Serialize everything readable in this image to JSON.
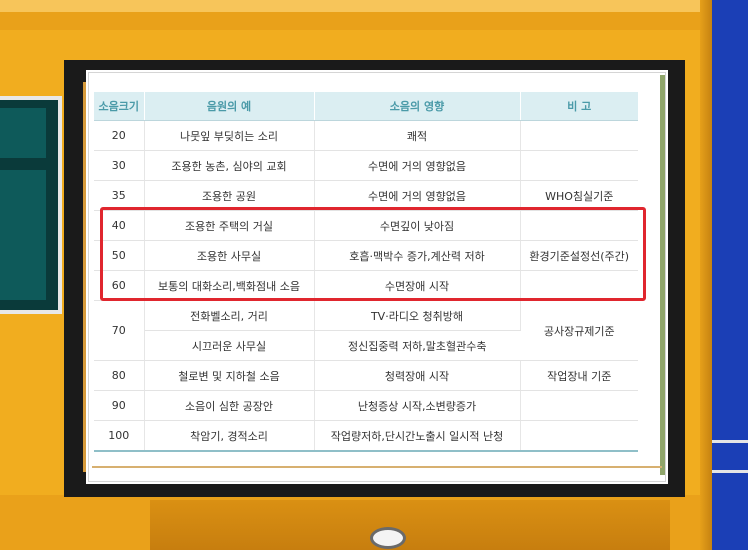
{
  "table": {
    "headers": [
      "소음크기",
      "음원의 예",
      "소음의 영향",
      "비 고"
    ],
    "rows": [
      {
        "db": "20",
        "source": "나뭇잎 부딪히는 소리",
        "effect": "쾌적",
        "note": ""
      },
      {
        "db": "30",
        "source": "조용한 농촌, 심야의 교회",
        "effect": "수면에 거의 영향없음",
        "note": ""
      },
      {
        "db": "35",
        "source": "조용한 공원",
        "effect": "수면에 거의 영향없음",
        "note": "WHO침실기준"
      },
      {
        "db": "40",
        "source": "조용한 주택의 거실",
        "effect": "수면깊이 낮아짐",
        "note": ""
      },
      {
        "db": "50",
        "source": "조용한 사무실",
        "effect": "호흡·맥박수 증가,계산력 저하",
        "note": "환경기준설정선(주간)"
      },
      {
        "db": "60",
        "source": "보통의 대화소리,백화점내 소음",
        "effect": "수면장애 시작",
        "note": ""
      },
      {
        "db": "70",
        "source": "전화벨소리, 거리",
        "effect": "TV·라디오 청취방해",
        "note": "공사장규제기준"
      },
      {
        "db": "",
        "source": "시끄러운 사무실",
        "effect": "정신집중력 저하,말초혈관수축",
        "note": ""
      },
      {
        "db": "80",
        "source": "철로변 및 지하철 소음",
        "effect": "청력장애 시작",
        "note": "작업장내 기준"
      },
      {
        "db": "90",
        "source": "소음이 심한 공장안",
        "effect": "난청증상 시작,소변량증가",
        "note": ""
      },
      {
        "db": "100",
        "source": "착암기, 경적소리",
        "effect": "작업량저하,단시간노출시 일시적 난청",
        "note": ""
      }
    ]
  },
  "colors": {
    "header_bg": "#dbeef2",
    "header_text": "#4a9aa8",
    "highlight": "#e0262e",
    "frame": "#1a1a1a",
    "wall": "#f1ad1f",
    "sky": "#1b3fb6"
  }
}
